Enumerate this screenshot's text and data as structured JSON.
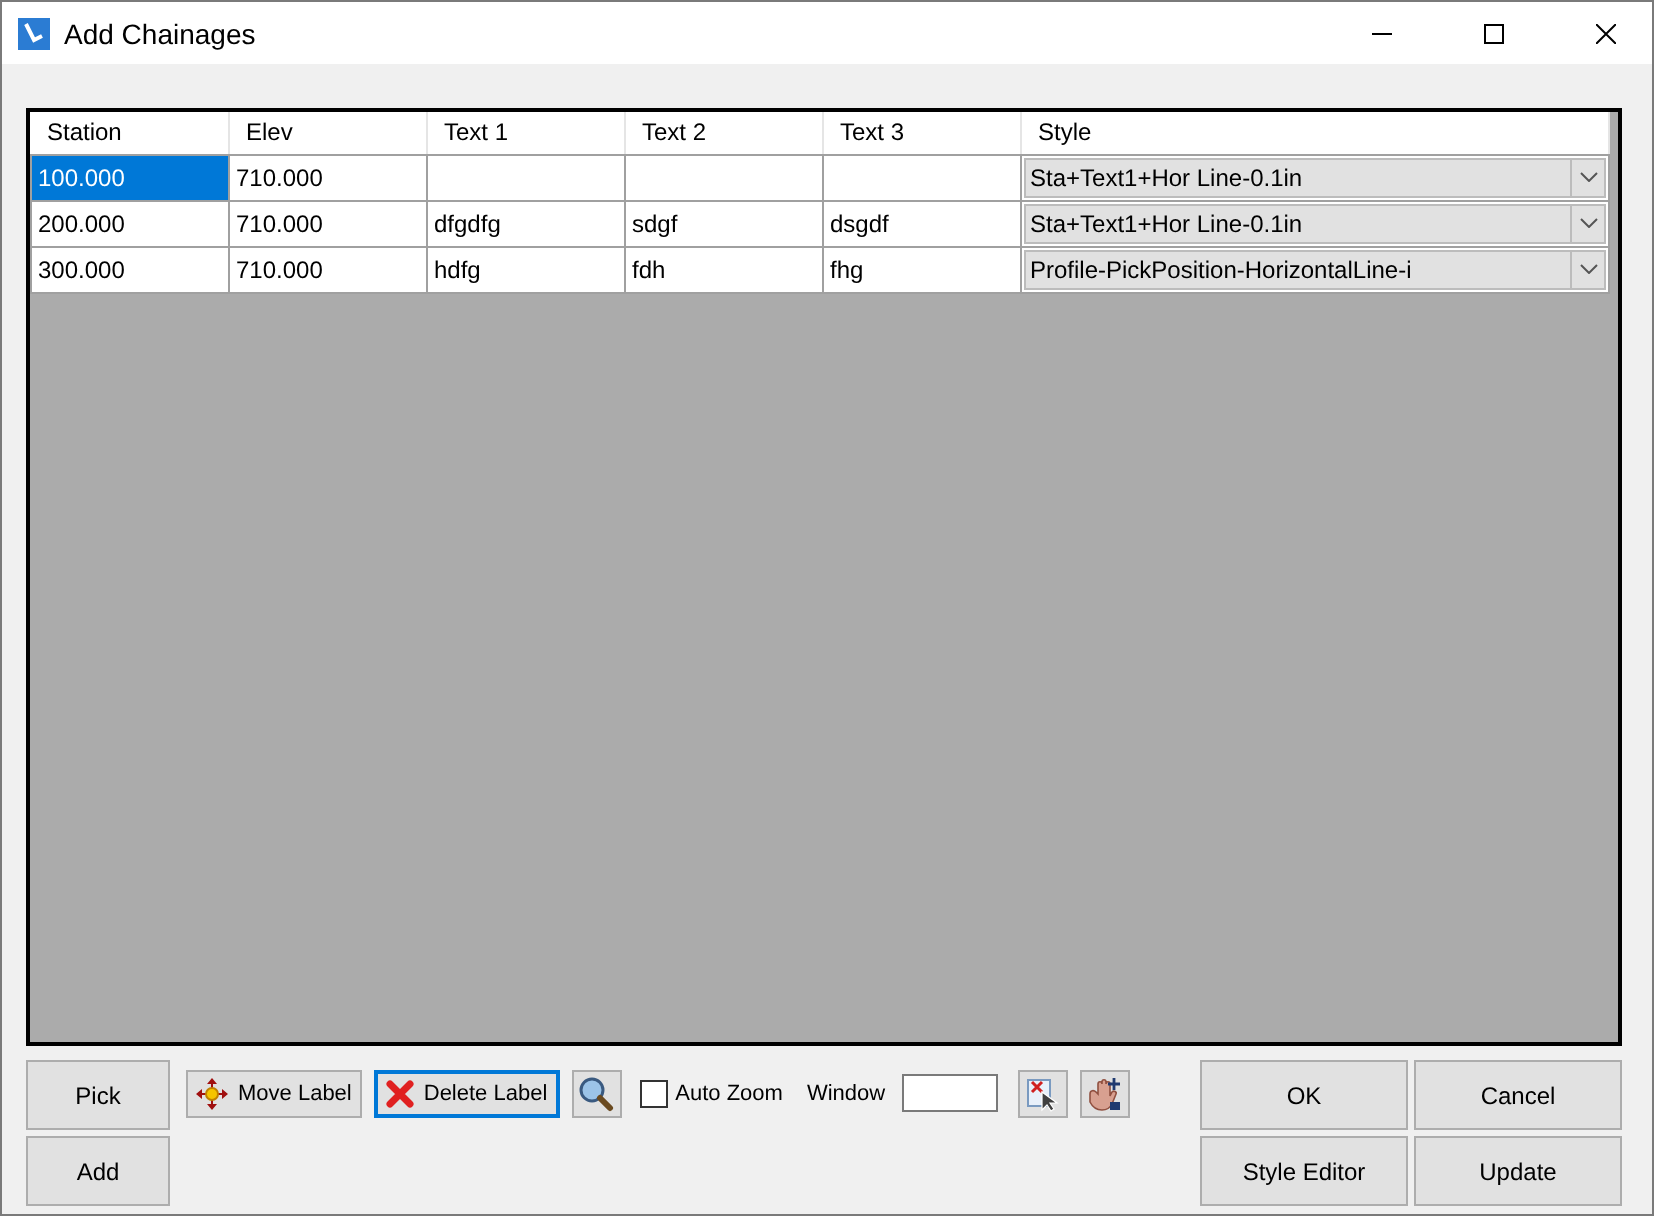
{
  "window": {
    "title": "Add Chainages"
  },
  "table": {
    "columns": [
      "Station",
      "Elev",
      "Text 1",
      "Text 2",
      "Text 3",
      "Style"
    ],
    "rows": [
      {
        "cells": [
          "100.000",
          "710.000",
          "",
          "",
          ""
        ],
        "style": "Sta+Text1+Hor Line-0.1in",
        "selected": true
      },
      {
        "cells": [
          "200.000",
          "710.000",
          "dfgdfg",
          "sdgf",
          "dsgdf"
        ],
        "style": "Sta+Text1+Hor Line-0.1in",
        "selected": false
      },
      {
        "cells": [
          "300.000",
          "710.000",
          "hdfg",
          "fdh",
          "fhg"
        ],
        "style": "Profile-PickPosition-HorizontalLine-i",
        "selected": false
      }
    ]
  },
  "left_buttons": [
    {
      "label": "Pick"
    },
    {
      "label": "Add"
    }
  ],
  "toolbar": [
    {
      "kind": "icon-text",
      "label": "Move Label",
      "focused": false
    },
    {
      "kind": "icon-text",
      "label": "Delete Label",
      "focused": true
    },
    {
      "kind": "icon",
      "focused": false
    }
  ],
  "auto_zoom": {
    "label": "Auto Zoom",
    "checked": false
  },
  "window_field": {
    "label": "Window"
  },
  "right_buttons": [
    {
      "label": "OK"
    },
    {
      "label": "Cancel"
    },
    {
      "label": "Style Editor"
    },
    {
      "label": "Update"
    }
  ]
}
